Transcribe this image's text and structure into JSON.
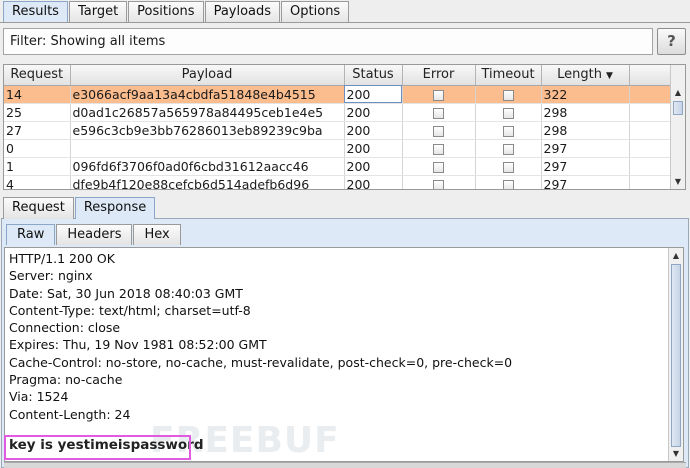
{
  "top_tabs": [
    "Results",
    "Target",
    "Positions",
    "Payloads",
    "Options"
  ],
  "filter": {
    "text": "Filter: Showing all items",
    "help_label": "?"
  },
  "table": {
    "columns": [
      "Request",
      "Payload",
      "Status",
      "Error",
      "Timeout",
      "Length"
    ],
    "sort_indicator": "▼",
    "rows": [
      {
        "request": "14",
        "payload": "e3066acf9aa13a4cbdfa51848e4b4515",
        "status": "200",
        "length": "322",
        "selected": true
      },
      {
        "request": "25",
        "payload": "d0ad1c26857a565978a84495ceb1e4e5",
        "status": "200",
        "length": "298"
      },
      {
        "request": "27",
        "payload": "e596c3cb9e3bb76286013eb89239c9ba",
        "status": "200",
        "length": "298"
      },
      {
        "request": "0",
        "payload": "",
        "status": "200",
        "length": "297"
      },
      {
        "request": "1",
        "payload": "096fd6f3706f0ad0f6cbd31612aacc46",
        "status": "200",
        "length": "297"
      },
      {
        "request": "4",
        "payload": "dfe9b4f120e88cefcb6d514adefb6d96",
        "status": "200",
        "length": "297"
      }
    ]
  },
  "msg_tabs": [
    "Request",
    "Response"
  ],
  "view_tabs": [
    "Raw",
    "Headers",
    "Hex"
  ],
  "response": {
    "lines": [
      "HTTP/1.1 200 OK",
      "Server: nginx",
      "Date: Sat, 30 Jun 2018 08:40:03 GMT",
      "Content-Type: text/html; charset=utf-8",
      "Connection: close",
      "Expires: Thu, 19 Nov 1981 08:52:00 GMT",
      "Cache-Control: no-store, no-cache, must-revalidate, post-check=0, pre-check=0",
      "Pragma: no-cache",
      "Via: 1524",
      "Content-Length: 24"
    ],
    "body": "key is yestimeispassword"
  },
  "watermark": "FREEBUF",
  "colors": {
    "selected_row": "#fbbd8e",
    "highlight_box": "#e05be0",
    "active_tab": "#dde9f6"
  }
}
